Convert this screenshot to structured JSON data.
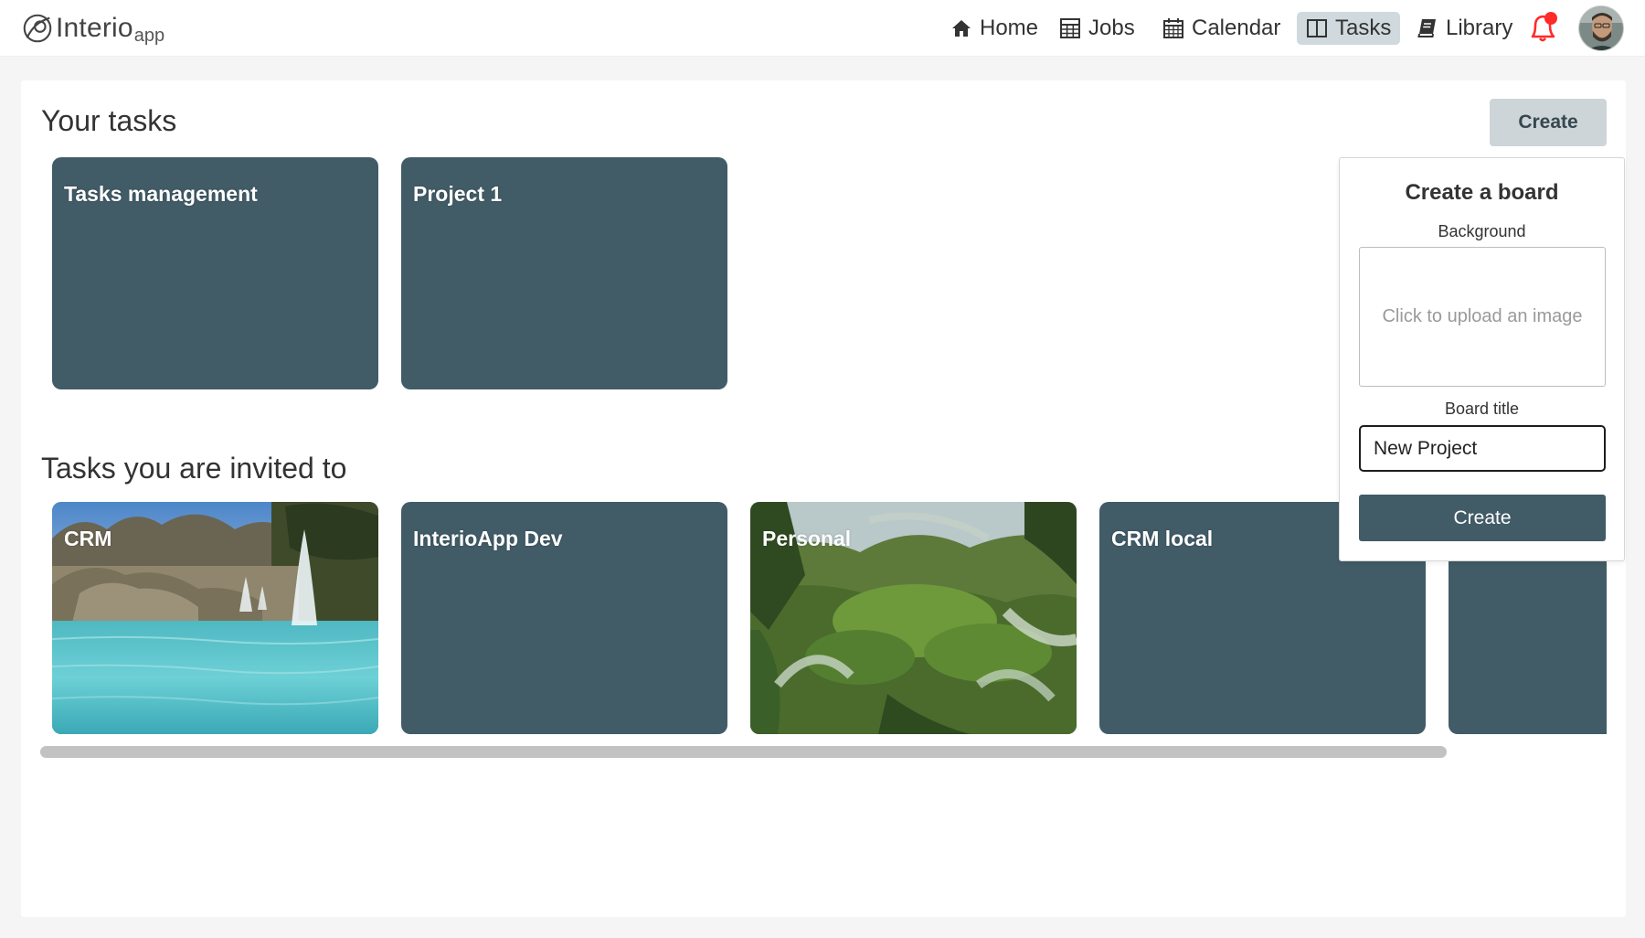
{
  "app": {
    "logo_text": "Interio",
    "logo_sub": "app"
  },
  "nav": {
    "items": [
      {
        "label": "Home",
        "icon": "home-icon"
      },
      {
        "label": "Jobs",
        "icon": "calculator-icon"
      },
      {
        "label": "Calendar",
        "icon": "calendar-icon"
      },
      {
        "label": "Tasks",
        "icon": "columns-icon",
        "active": true
      },
      {
        "label": "Library",
        "icon": "book-icon"
      }
    ],
    "bell_icon": "bell-icon",
    "notification_color": "#ff2a2a"
  },
  "tasks": {
    "your_tasks_title": "Your tasks",
    "create_label": "Create",
    "your_boards": [
      {
        "title": "Tasks management"
      },
      {
        "title": "Project 1"
      }
    ],
    "invited_title": "Tasks you are invited to",
    "invited_boards": [
      {
        "title": "CRM",
        "background": "fountain-photo"
      },
      {
        "title": "InterioApp Dev"
      },
      {
        "title": "Personal",
        "background": "jungle-photo"
      },
      {
        "title": "CRM local"
      },
      {
        "title": ""
      }
    ]
  },
  "create_board": {
    "title": "Create a board",
    "background_label": "Background",
    "upload_placeholder": "Click to upload an image",
    "board_title_label": "Board title",
    "board_title_value": "New Project",
    "create_label": "Create"
  },
  "colors": {
    "board": "#415b67",
    "active_nav": "#cfd9de",
    "create_button": "#cdd5d9"
  }
}
